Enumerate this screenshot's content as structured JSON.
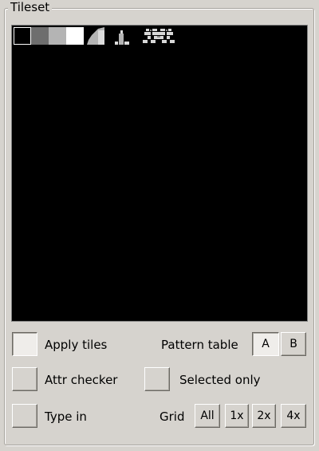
{
  "groupbox": {
    "title": "Tileset"
  },
  "tileset": {
    "tiles": [
      {
        "name": "tile-black-icon",
        "color": "#000000"
      },
      {
        "name": "tile-dark-gray-icon",
        "color": "#6e6e6e"
      },
      {
        "name": "tile-light-gray-icon",
        "color": "#b4b4b4"
      },
      {
        "name": "tile-white-icon",
        "color": "#ffffff"
      },
      {
        "name": "tile-slope-icon",
        "color": "#b4b4b4"
      },
      {
        "name": "tile-bottle-icon",
        "color": "#b4b4b4"
      },
      {
        "name": "tile-sprite-icon",
        "color": "#b4b4b4"
      }
    ]
  },
  "controls": {
    "apply_tiles": {
      "label": "Apply tiles",
      "checked": true
    },
    "attr_checker": {
      "label": "Attr checker",
      "checked": false
    },
    "type_in": {
      "label": "Type in",
      "checked": false
    },
    "selected_only": {
      "label": "Selected only",
      "checked": false
    },
    "pattern_table": {
      "label": "Pattern table",
      "options": [
        "A",
        "B"
      ],
      "selected": "A"
    },
    "grid": {
      "label": "Grid",
      "options": [
        "All",
        "1x",
        "2x",
        "4x"
      ]
    }
  }
}
